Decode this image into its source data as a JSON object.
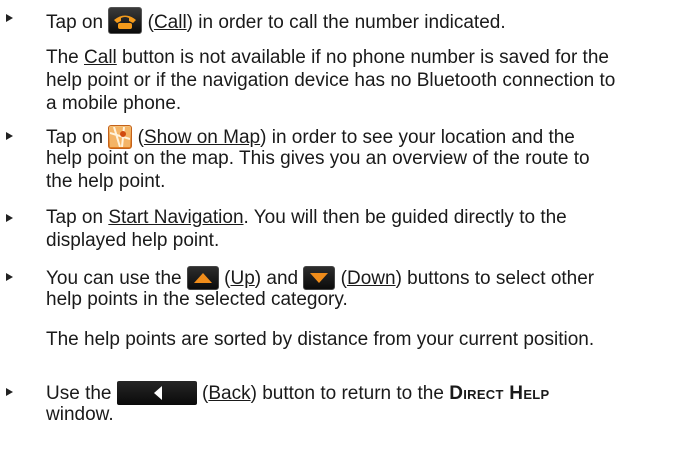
{
  "items": [
    {
      "before": "Tap on",
      "button_name": "Call",
      "after": "in order to call the number indicated.",
      "note_pre": "The",
      "note_link": "Call",
      "note_post": "button is not available if no phone number is saved for the",
      "note_line2": "help point or if the navigation device has no Bluetooth connection to",
      "note_line3": "a mobile phone."
    },
    {
      "before": "Tap on",
      "button_name": "Show on Map",
      "after": "in order to see your location and the",
      "line2": "help point on the map. This gives you an overview of the route to",
      "line3": "the help point."
    },
    {
      "before": "Tap on",
      "link": "Start Navigation",
      "after": ". You will then be guided directly to the",
      "line2": "displayed help point."
    },
    {
      "before": "You can use the",
      "up_name": "Up",
      "middle": "and",
      "down_name": "Down",
      "after": "buttons to select other",
      "line2": "help points in the selected category.",
      "note": "The help points are sorted by distance from your current position."
    },
    {
      "before": "Use the",
      "button_name": "Back",
      "after": "button to return to the",
      "window_name": "Direct Help",
      "line2": "window."
    }
  ],
  "icons": {
    "call": "call-icon",
    "map": "show-on-map-icon",
    "up": "up-arrow-icon",
    "down": "down-arrow-icon",
    "back": "back-arrow-icon"
  },
  "colors": {
    "call_handset": "#f39a1b",
    "map_orange": "#e88a2a",
    "arrow_orange": "#f08c1a"
  }
}
